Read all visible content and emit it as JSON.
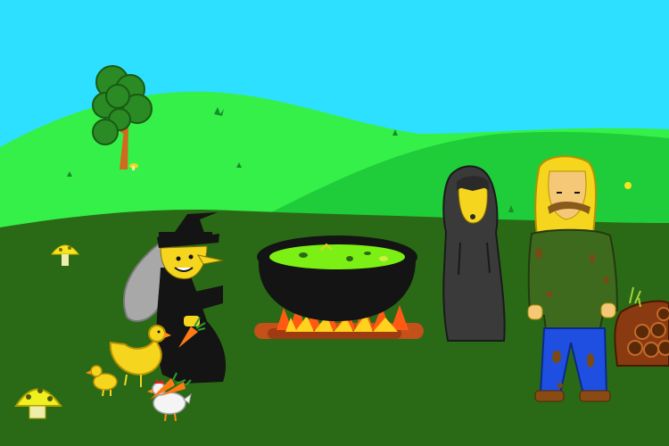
{
  "scene": {
    "type": "point-and-click adventure game screen",
    "hud_text": []
  },
  "colors": {
    "sky": "#2EE0FF",
    "far_hill": "#35F048",
    "mid_hill": "#1FCC3A",
    "ground": "#2A6A16",
    "potion_green": "#7CF014",
    "fire_orange": "#FF6A1A",
    "witch_black": "#141414",
    "hair_gray": "#A8A8A8",
    "skin_yellow": "#F5D51E",
    "farmer_shirt": "#3E6A1E",
    "farmer_jeans": "#1F4FE0",
    "log_brown": "#7A3A12"
  },
  "characters": [
    {
      "name": "witch",
      "icon": "witch-icon"
    },
    {
      "name": "hooded-figure",
      "icon": "hooded-figure-icon"
    },
    {
      "name": "farmer",
      "icon": "farmer-icon"
    }
  ],
  "objects": [
    "cauldron",
    "campfire",
    "woodpile",
    "tree",
    "mushroom",
    "mushroom-small",
    "chicken",
    "chick",
    "rooster",
    "carrot"
  ]
}
